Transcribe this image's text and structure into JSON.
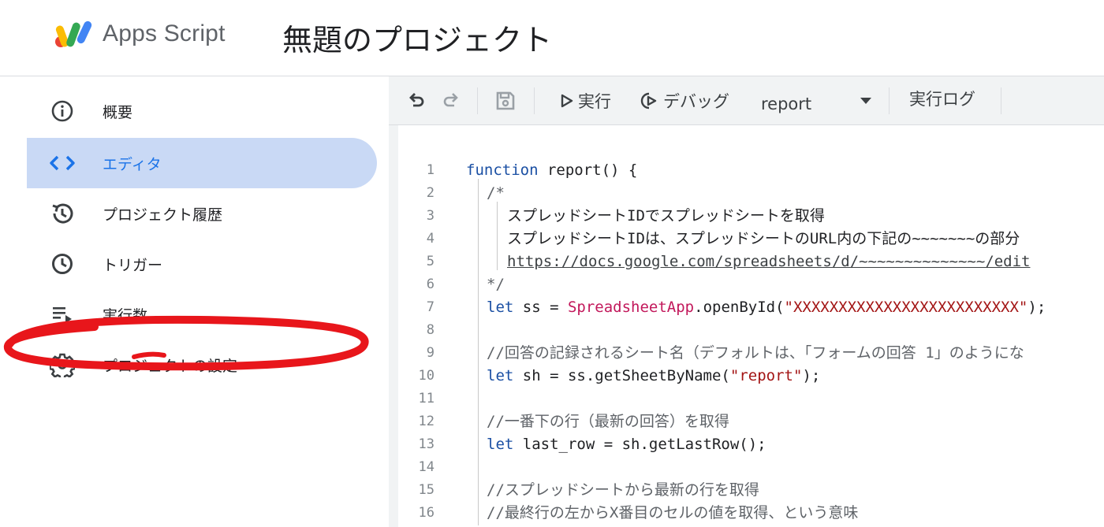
{
  "header": {
    "brand": "Apps Script",
    "project_title": "無題のプロジェクト"
  },
  "sidebar": {
    "items": [
      {
        "label": "概要",
        "icon": "info-icon",
        "active": false
      },
      {
        "label": "エディタ",
        "icon": "code-icon",
        "active": true
      },
      {
        "label": "プロジェクト履歴",
        "icon": "history-icon",
        "active": false
      },
      {
        "label": "トリガー",
        "icon": "clock-icon",
        "active": false
      },
      {
        "label": "実行数",
        "icon": "executions-icon",
        "active": false
      },
      {
        "label": "プロジェクトの設定",
        "icon": "gear-icon",
        "active": false
      }
    ],
    "active_color": "#c9d9f5",
    "annotation_color": "#e8161b"
  },
  "toolbar": {
    "run_label": "実行",
    "debug_label": "デバッグ",
    "function_name": "report",
    "log_label": "実行ログ"
  },
  "code": {
    "lines": [
      {
        "n": "1",
        "text": "function report() {"
      },
      {
        "n": "2",
        "text": "/*"
      },
      {
        "n": "3",
        "text": "スプレッドシートIDでスプレッドシートを取得"
      },
      {
        "n": "4",
        "text": "スプレッドシートIDは、スプレッドシートのURL内の下記の~~~~~~~の部分"
      },
      {
        "n": "5",
        "text": "https://docs.google.com/spreadsheets/d/~~~~~~~~~~~~~~/edit"
      },
      {
        "n": "6",
        "text": "*/"
      },
      {
        "n": "7",
        "text": "let ss = SpreadsheetApp.openById(\"XXXXXXXXXXXXXXXXXXXXXXXXX\");"
      },
      {
        "n": "8",
        "text": ""
      },
      {
        "n": "9",
        "text": "//回答の記録されるシート名（デフォルトは、「フォームの回答 1」のようにな"
      },
      {
        "n": "10",
        "text": "let sh = ss.getSheetByName(\"report\");"
      },
      {
        "n": "11",
        "text": ""
      },
      {
        "n": "12",
        "text": "//一番下の行（最新の回答）を取得"
      },
      {
        "n": "13",
        "text": "let last_row = sh.getLastRow();"
      },
      {
        "n": "14",
        "text": ""
      },
      {
        "n": "15",
        "text": "//スプレッドシートから最新の行を取得"
      },
      {
        "n": "16",
        "text": "//最終行の左からX番目のセルの値を取得、という意味"
      }
    ]
  }
}
